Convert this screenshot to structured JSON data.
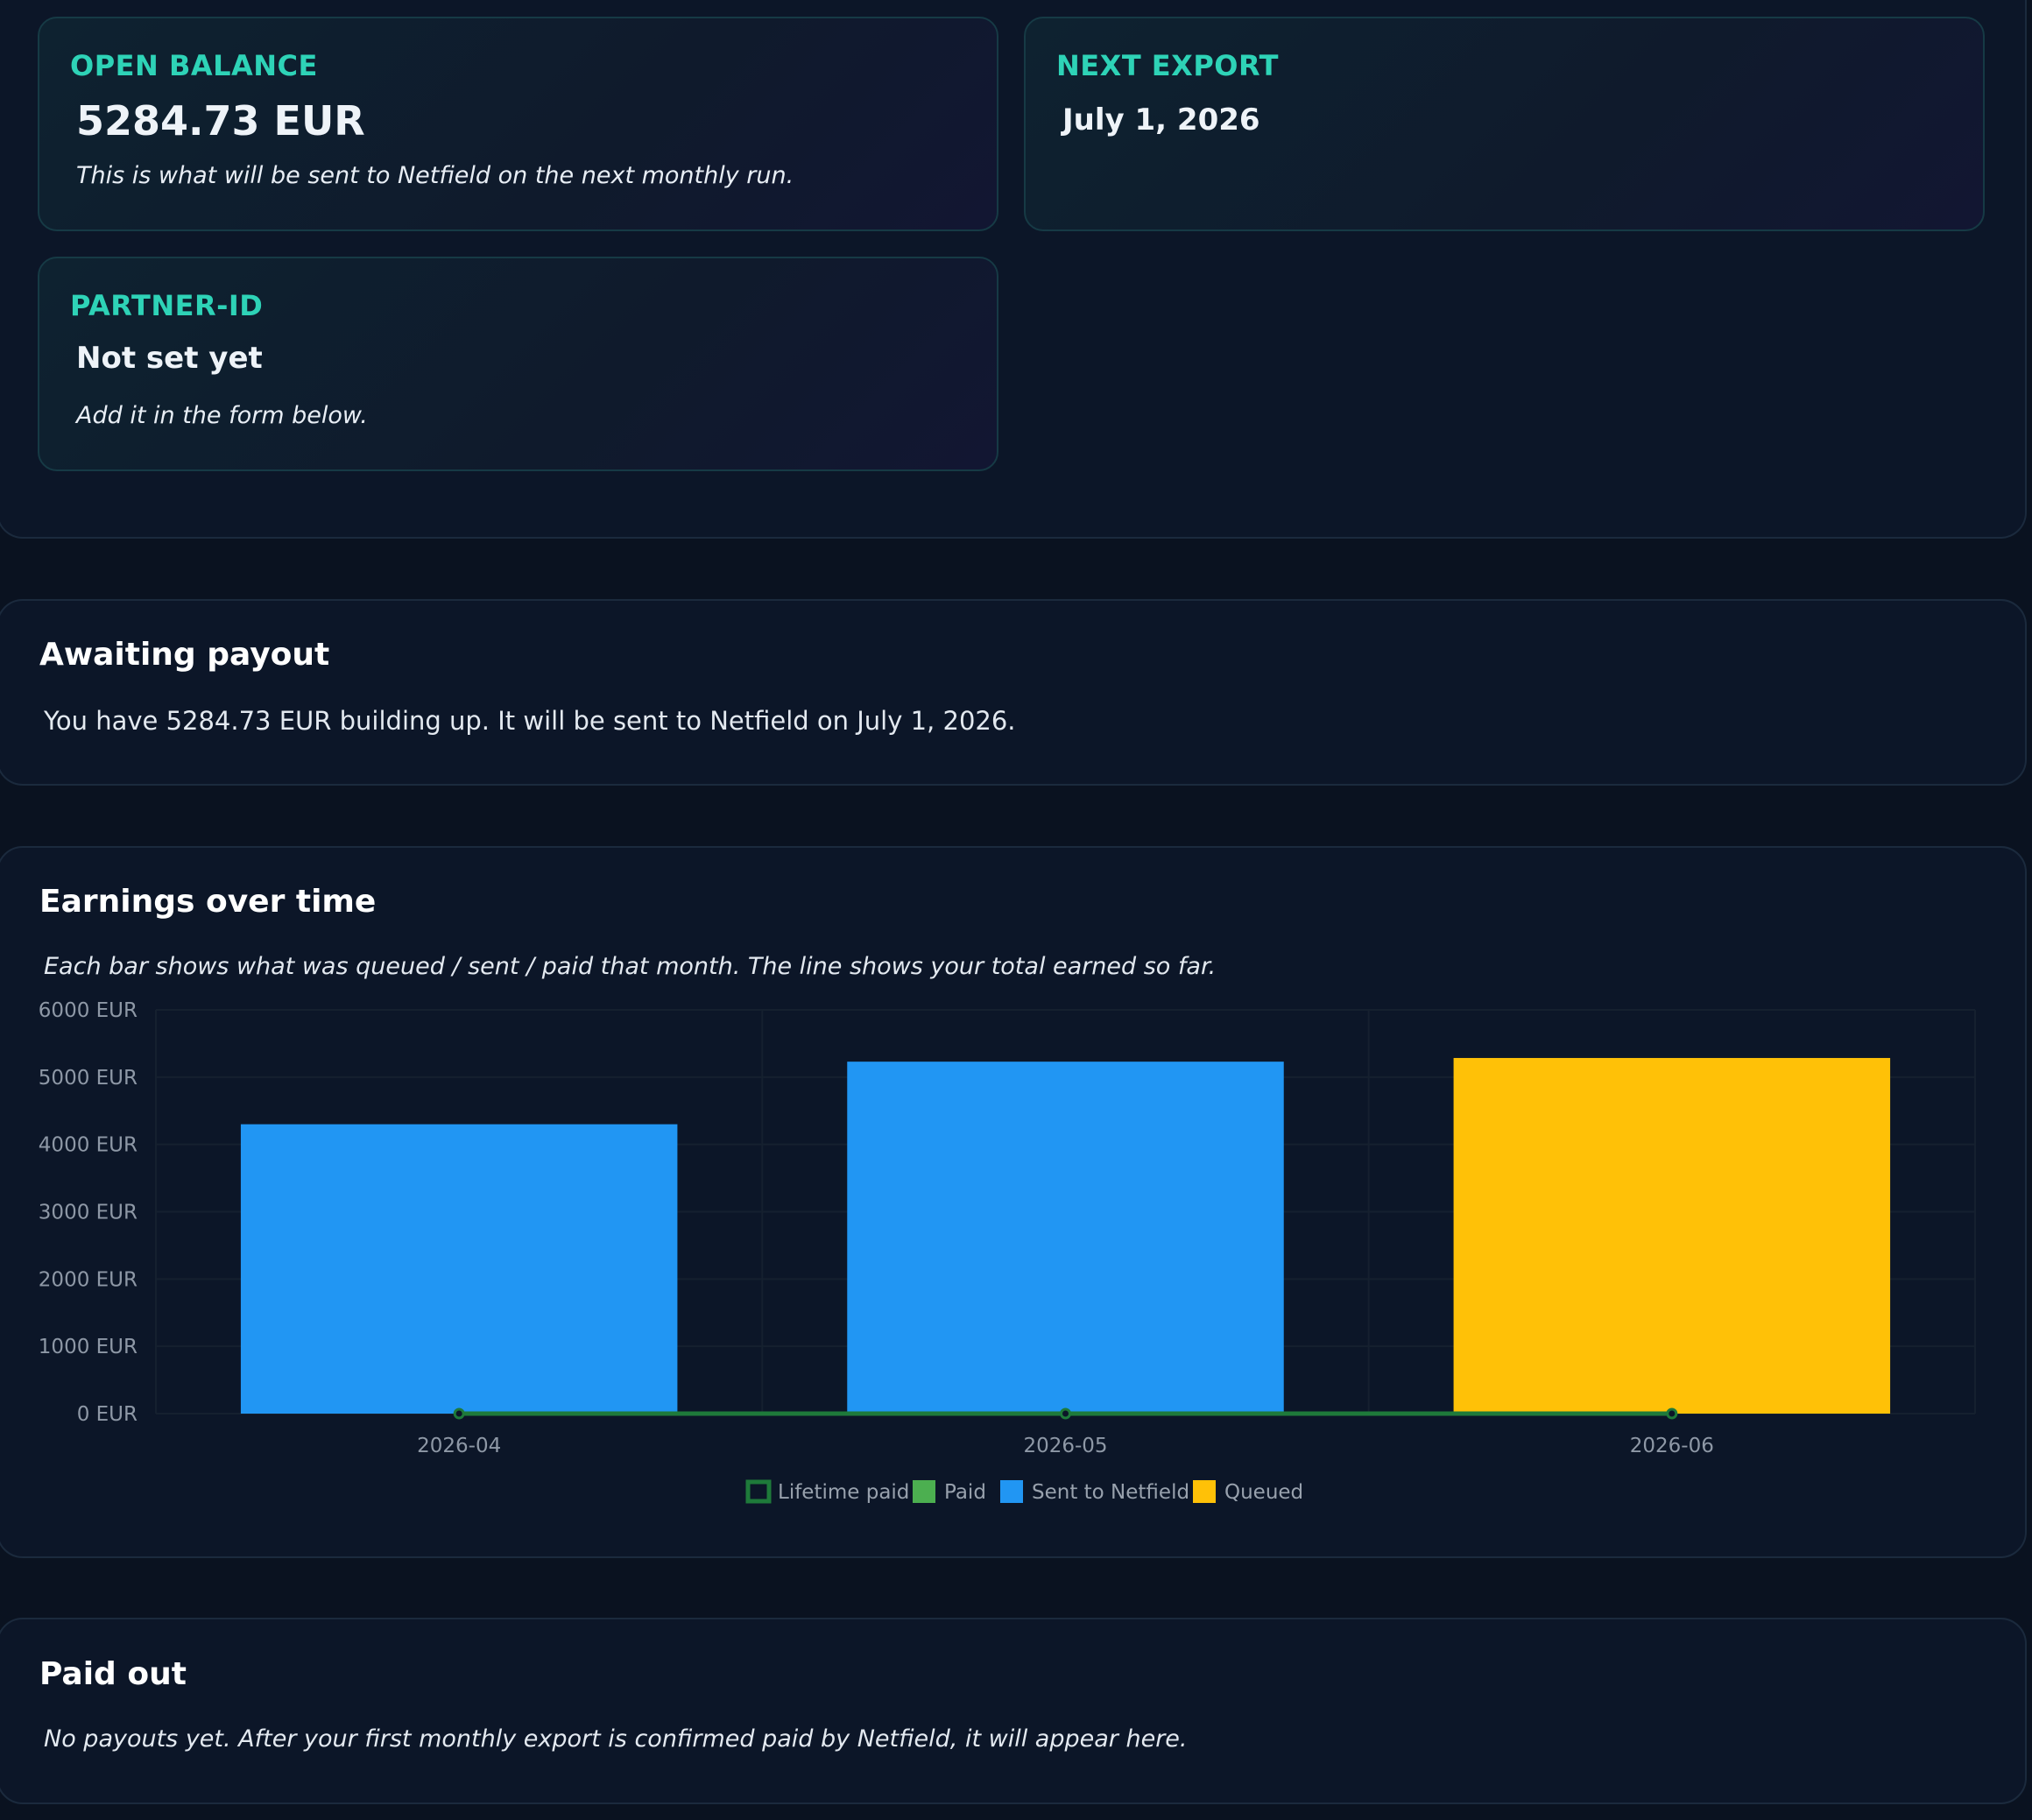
{
  "overview": {
    "open_balance": {
      "label": "OPEN BALANCE",
      "value": "5284.73 EUR",
      "note": "This is what will be sent to Netfield on the next monthly run."
    },
    "next_export": {
      "label": "NEXT EXPORT",
      "value": "July 1, 2026"
    },
    "partner_id": {
      "label": "PARTNER-ID",
      "value": "Not set yet",
      "note": "Add it in the form below."
    }
  },
  "awaiting": {
    "title": "Awaiting payout",
    "text": "You have 5284.73 EUR building up. It will be sent to Netfield on July 1, 2026."
  },
  "earnings": {
    "title": "Earnings over time",
    "description": "Each bar shows what was queued / sent / paid that month. The line shows your total earned so far."
  },
  "paid_out": {
    "title": "Paid out",
    "text": "No payouts yet. After your first monthly export is confirmed paid by Netfield, it will appear here."
  },
  "chart_data": {
    "type": "bar",
    "categories": [
      "2026-04",
      "2026-05",
      "2026-06"
    ],
    "series": [
      {
        "name": "Paid",
        "type": "bar",
        "color": "#4caf50",
        "values": [
          0,
          0,
          0
        ]
      },
      {
        "name": "Sent to Netfield",
        "type": "bar",
        "color": "#2196f3",
        "values": [
          4300,
          5230,
          0
        ]
      },
      {
        "name": "Queued",
        "type": "bar",
        "color": "#ffc107",
        "values": [
          0,
          0,
          5284.73
        ]
      },
      {
        "name": "Lifetime paid",
        "type": "line",
        "color": "#1e7a3a",
        "values": [
          0,
          0,
          0
        ]
      }
    ],
    "yticks": [
      "0 EUR",
      "1000 EUR",
      "2000 EUR",
      "3000 EUR",
      "4000 EUR",
      "5000 EUR",
      "6000 EUR"
    ],
    "ylim": [
      0,
      6000
    ],
    "grid": true,
    "legend_position": "bottom-center"
  }
}
